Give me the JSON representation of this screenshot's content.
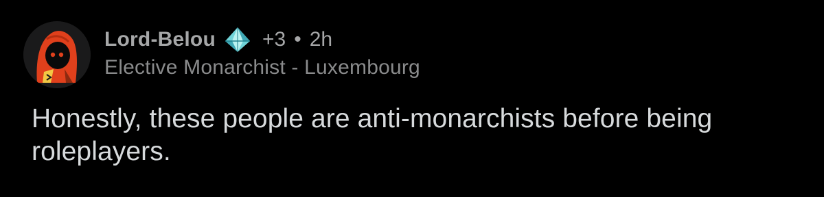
{
  "comment": {
    "username": "Lord-Belou",
    "flair_icon": "diamond-crystal-icon",
    "award_count": "+3",
    "separator": "•",
    "time": "2h",
    "user_flair": "Elective Monarchist - Luxembourg",
    "body": "Honestly, these people are anti-monarchists before being roleplayers.",
    "avatar_icon": "hooded-figure-avatar-icon"
  },
  "colors": {
    "background": "#000000",
    "username": "#a6a7a8",
    "secondary_text": "#8a8b8c",
    "body_text": "#d7dadc",
    "avatar_hood": "#e0401c",
    "diamond": "#6fd3d8"
  }
}
